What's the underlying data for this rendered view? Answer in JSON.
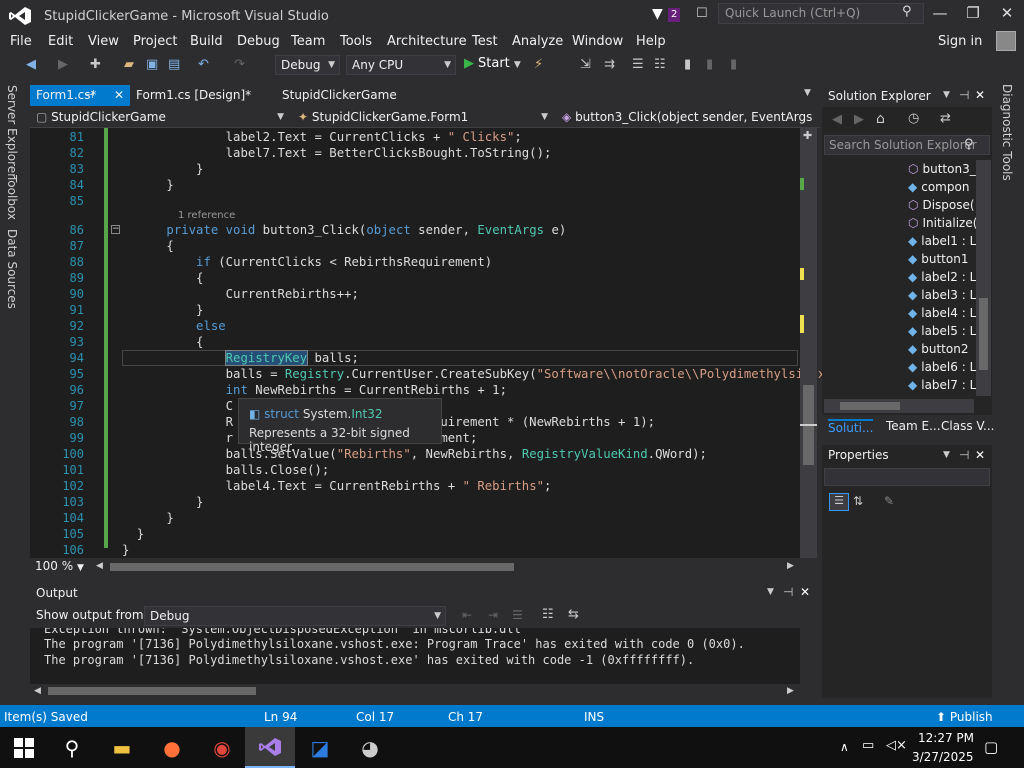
{
  "window": {
    "title": "StupidClickerGame - Microsoft Visual Studio",
    "notification_count": "2",
    "quick_launch_placeholder": "Quick Launch (Ctrl+Q)"
  },
  "menu": [
    "File",
    "Edit",
    "View",
    "Project",
    "Build",
    "Debug",
    "Team",
    "Tools",
    "Architecture",
    "Test",
    "Analyze",
    "Window",
    "Help"
  ],
  "signin_label": "Sign in",
  "toolbar": {
    "config": "Debug",
    "platform": "Any CPU",
    "start_label": "Start"
  },
  "side_tabs": [
    "Server Explorer",
    "Toolbox",
    "Data Sources"
  ],
  "doc_tabs": {
    "active": "Form1.cs*",
    "design": "Form1.cs [Design]*",
    "project": "StupidClickerGame"
  },
  "nav": {
    "project": "StupidClickerGame",
    "class": "StupidClickerGame.Form1",
    "member": "button3_Click(object sender, EventArgs e)"
  },
  "editor": {
    "line_numbers": [
      "81",
      "82",
      "83",
      "84",
      "85",
      "86",
      "87",
      "88",
      "89",
      "90",
      "91",
      "92",
      "93",
      "94",
      "95",
      "96",
      "97",
      "98",
      "99",
      "100",
      "101",
      "102",
      "103",
      "104",
      "105",
      "106"
    ],
    "reference_hint": "1 reference",
    "zoom": "100 %",
    "tooltip_kind": "struct",
    "tooltip_ns": "System.",
    "tooltip_type": "Int32",
    "tooltip_desc": "Represents a 32-bit signed integer."
  },
  "output": {
    "title": "Output",
    "show_from_label": "Show output from:",
    "source": "Debug",
    "lines": [
      "Exception thrown: 'System.ObjectDisposedException' in mscorlib.dll",
      "The program '[7136] Polydimethylsiloxane.vshost.exe: Program Trace' has exited with code 0 (0x0).",
      "The program '[7136] Polydimethylsiloxane.vshost.exe' has exited with code -1 (0xffffffff)."
    ]
  },
  "solution_explorer": {
    "title": "Solution Explorer",
    "search_placeholder": "Search Solution Explorer",
    "items": [
      "button3_",
      "compon",
      "Dispose(",
      "Initialize(",
      "label1 : L",
      "button1",
      "label2 : L",
      "label3 : L",
      "label4 : L",
      "label5 : L",
      "button2",
      "label6 : L",
      "label7 : L"
    ],
    "tabs": [
      "Soluti...",
      "Team E...",
      "Class V..."
    ]
  },
  "properties": {
    "title": "Properties"
  },
  "diagnostic_tools": "Diagnostic Tools",
  "status": {
    "message": "Item(s) Saved",
    "ln": "Ln 94",
    "col": "Col 17",
    "ch": "Ch 17",
    "mode": "INS",
    "publish": "Publish"
  },
  "clock": {
    "time": "12:27 PM",
    "date": "3/27/2025"
  }
}
